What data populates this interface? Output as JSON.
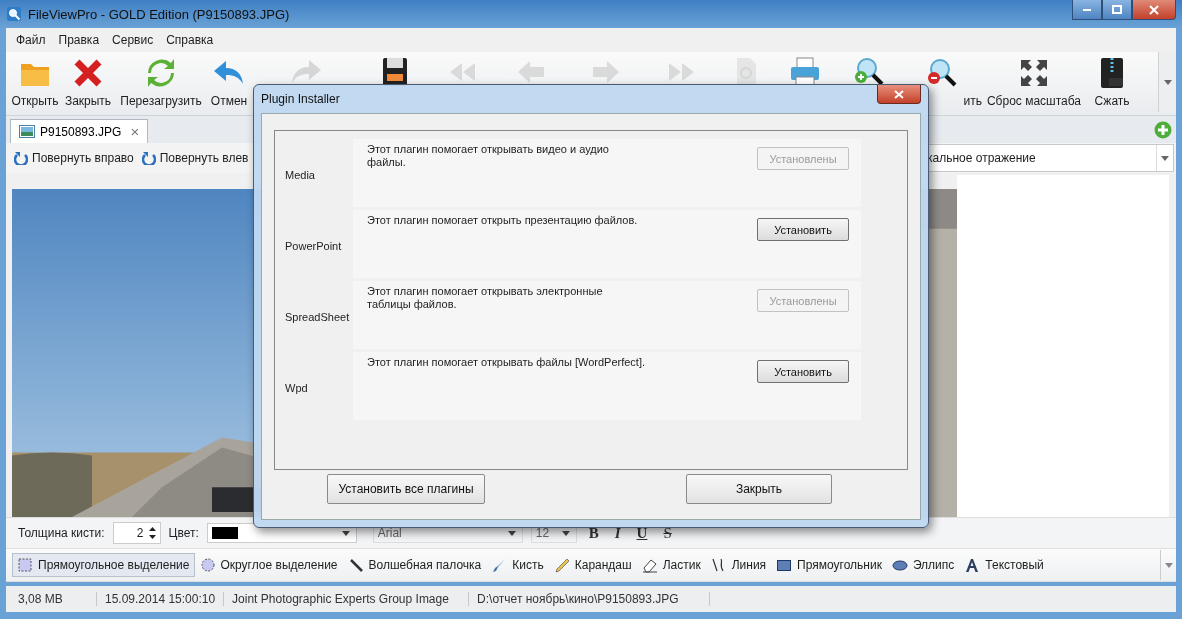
{
  "window": {
    "title": "FileViewPro - GOLD Edition (P9150893.JPG)"
  },
  "menu": [
    "Файл",
    "Правка",
    "Сервис",
    "Справка"
  ],
  "toolbar": [
    {
      "kind": "open",
      "label": "Открыть",
      "disabled": false
    },
    {
      "kind": "close",
      "label": "Закрыть",
      "disabled": false
    },
    {
      "kind": "reload",
      "label": "Перезагрузить",
      "disabled": false
    },
    {
      "kind": "undo",
      "label": "Отмен",
      "disabled": false
    },
    {
      "kind": "redo",
      "disabled": true
    },
    {
      "kind": "save",
      "disabled": false
    },
    {
      "kind": "first",
      "disabled": true
    },
    {
      "kind": "prev",
      "disabled": true
    },
    {
      "kind": "next",
      "disabled": true
    },
    {
      "kind": "last",
      "disabled": true
    },
    {
      "kind": "find",
      "disabled": true
    },
    {
      "kind": "print",
      "disabled": false
    },
    {
      "kind": "zoomin",
      "disabled": false
    },
    {
      "kind": "zoomout",
      "label": "ить",
      "disabled": false
    },
    {
      "kind": "reset",
      "label": "Сброс масштаба",
      "disabled": false
    },
    {
      "kind": "zip",
      "label": "Сжать",
      "disabled": false
    }
  ],
  "tabs": [
    {
      "label": "P9150893.JPG",
      "selected": true,
      "close": "×"
    }
  ],
  "image_toolbar": {
    "items": [
      "Повернуть вправо",
      "Повернуть влев"
    ],
    "dropdown": "кальное отражение"
  },
  "brush_bar": {
    "thickness_label": "Толщина кисти:",
    "thickness": "2",
    "color_label": "Цвет:",
    "color": "#000000",
    "font": "Arial",
    "size": "12",
    "styles": [
      "B",
      "I",
      "U",
      "S"
    ]
  },
  "tools": [
    {
      "kind": "rect-select",
      "label": "Прямоугольное выделение",
      "selected": true
    },
    {
      "kind": "ellipse-select",
      "label": "Округлое выделение",
      "selected": false
    },
    {
      "kind": "wand",
      "label": "Волшебная палочка",
      "selected": false
    },
    {
      "kind": "brush",
      "label": "Кисть",
      "selected": false
    },
    {
      "kind": "pencil",
      "label": "Карандаш",
      "selected": false
    },
    {
      "kind": "eraser",
      "label": "Ластик",
      "selected": false
    },
    {
      "kind": "line",
      "label": "Линия",
      "selected": false
    },
    {
      "kind": "rectangle",
      "label": "Прямоугольник",
      "selected": false
    },
    {
      "kind": "ellipse",
      "label": "Эллипс",
      "selected": false
    },
    {
      "kind": "text",
      "label": "Текстовый",
      "selected": false
    }
  ],
  "status_bar": [
    "3,08 MB",
    "15.09.2014 15:00:10",
    "Joint Photographic Experts Group Image",
    "D:\\отчет  ноябрь\\кино\\P9150893.JPG"
  ],
  "dialog": {
    "title": "Plugin Installer",
    "plugins": [
      {
        "name": "Media",
        "description": "Этот плагин помогает открывать видео и аудио файлы.",
        "button": "Установлены",
        "installed": true
      },
      {
        "name": "PowerPoint",
        "description": "Этот плагин помогает открыть презентацию файлов.",
        "button": "Установить",
        "installed": false
      },
      {
        "name": "SpreadSheet",
        "description": "Этот плагин помогает открывать электронные таблицы файлов.",
        "button": "Установлены",
        "installed": true
      },
      {
        "name": "Wpd",
        "description": "Этот плагин помогает открывать файлы [WordPerfect].",
        "button": "Установить",
        "installed": false
      }
    ],
    "buttons": [
      "Установить все плагины",
      "Закрыть"
    ]
  }
}
